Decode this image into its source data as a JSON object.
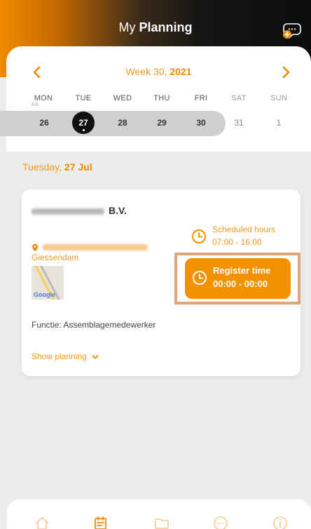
{
  "header": {
    "title_prefix": "My",
    "title_bold": "Planning",
    "chat_icon": "chat-add-icon"
  },
  "calendar": {
    "week_prefix": "Week 30,",
    "week_year": "2021",
    "days": [
      "MON",
      "TUE",
      "WED",
      "THU",
      "FRI",
      "SAT",
      "SUN"
    ],
    "mon_sub": "JUL",
    "dates": [
      "26",
      "27",
      "28",
      "29",
      "30",
      "31",
      "1"
    ],
    "selected_date": "27"
  },
  "day_title": {
    "prefix": "Tuesday,",
    "bold": "27 Jul"
  },
  "card": {
    "company_suffix": "B.V.",
    "city": "Giessendam",
    "map_label": "Google",
    "function": "Functie: Assemblagemedewerker",
    "show_planning": "Show planning",
    "scheduled_label": "Scheduled hours",
    "scheduled_time": "07:00 - 16:00",
    "register_label": "Register time",
    "register_time": "00:00 - 00:00"
  },
  "bottom_nav": [
    "home-icon",
    "planning-icon",
    "folder-icon",
    "more-icon",
    "info-icon"
  ],
  "colors": {
    "accent": "#f39200",
    "header_dark": "#111111",
    "highlight_border": "#dea77a"
  }
}
